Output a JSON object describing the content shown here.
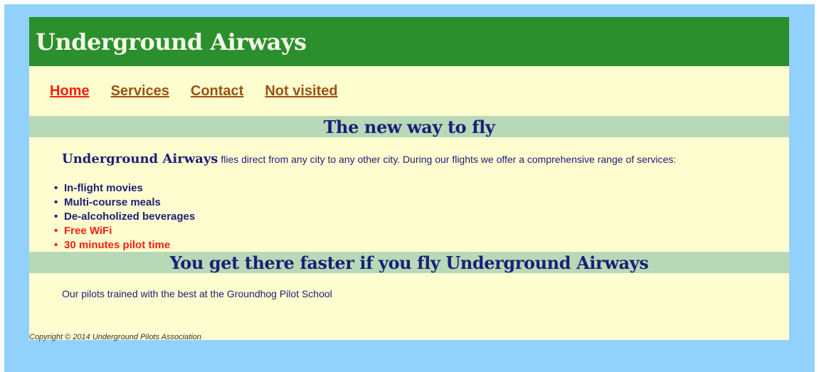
{
  "header": {
    "title": "Underground Airways"
  },
  "nav": {
    "home": "Home",
    "services": "Services",
    "contact": "Contact",
    "not_visited": "Not visited"
  },
  "section1": {
    "heading": "The new way to fly",
    "brand": "Underground Airways",
    "intro": " flies direct from any city to any other city. During our flights we offer a comprehensive range of services:",
    "services": [
      "In-flight movies",
      "Multi-course meals",
      "De-alcoholized beverages",
      "Free WiFi",
      "30 minutes pilot time"
    ]
  },
  "section2": {
    "heading": "You get there faster if you fly Underground Airways",
    "text": "Our pilots trained with the best at the Groundhog Pilot School"
  },
  "footer": {
    "copyright": "Copyright © 2014 Underground Pilots Association"
  },
  "colors": {
    "outer_background": "#93d1fd",
    "page_background": "#fefdd0",
    "header_green": "#2a8f2c",
    "band_green": "#b7d9b7",
    "text_navy": "#1b1f76",
    "link_active_red": "#fb1d0c",
    "link_visited_brown": "#9b5210"
  }
}
